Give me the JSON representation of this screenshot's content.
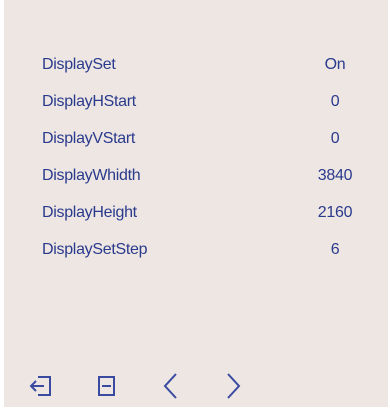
{
  "settings": [
    {
      "label": "DisplaySet",
      "value": "On"
    },
    {
      "label": "DisplayHStart",
      "value": "0"
    },
    {
      "label": "DisplayVStart",
      "value": "0"
    },
    {
      "label": "DisplayWhidth",
      "value": "3840"
    },
    {
      "label": "DisplayHeight",
      "value": "2160"
    },
    {
      "label": "DisplaySetStep",
      "value": "6"
    }
  ],
  "toolbar": {
    "buttons": [
      {
        "icon": "exit-icon"
      },
      {
        "icon": "menu-icon"
      },
      {
        "icon": "chevron-left-icon"
      },
      {
        "icon": "chevron-right-icon"
      }
    ]
  },
  "colors": {
    "text": "#2a3a8c",
    "panel_background": "#ede6e3",
    "icon": "#3a4aa0"
  }
}
